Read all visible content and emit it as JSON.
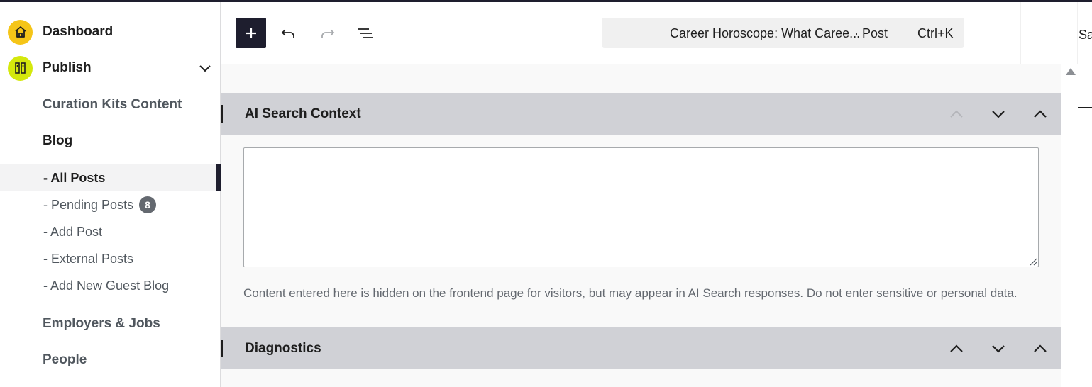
{
  "sidebar": {
    "dashboard_label": "Dashboard",
    "publish_label": "Publish",
    "curation_label": "Curation Kits Content",
    "blog_label": "Blog",
    "posts": [
      {
        "label": "- All Posts"
      },
      {
        "label": "- Pending Posts",
        "badge": "8"
      },
      {
        "label": "- Add Post"
      },
      {
        "label": "- External Posts"
      },
      {
        "label": "- Add New Guest Blog"
      }
    ],
    "employers_label": "Employers & Jobs",
    "people_label": "People",
    "icons": {
      "dashboard": "home-icon",
      "publish": "publish-icon",
      "publish_toggle": "chevron-down-icon"
    },
    "colors": {
      "dashboard_circle": "#f5c518",
      "publish_circle": "#d4e80c",
      "active_marker": "#1e1e2e"
    }
  },
  "toolbar": {
    "command_bar": {
      "title": "Career Horoscope: What Caree...",
      "type": "· Post",
      "shortcut": "Ctrl+K"
    },
    "right_text": "Sa",
    "icons": {
      "add": "plus-icon",
      "undo": "undo-icon",
      "redo": "redo-icon",
      "list": "document-overview-icon"
    }
  },
  "panels": [
    {
      "title": "AI Search Context",
      "textarea_value": "",
      "help": "Content entered here is hidden on the frontend page for visitors, but may appear in AI Search responses. Do not enter sensitive or personal data."
    },
    {
      "title": "Diagnostics"
    }
  ]
}
